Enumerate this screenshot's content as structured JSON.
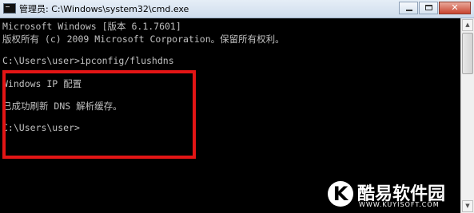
{
  "window": {
    "title": "管理员: C:\\Windows\\system32\\cmd.exe",
    "icon": "cmd-icon",
    "buttons": {
      "minimize": "minimize-icon",
      "maximize": "maximize-icon",
      "close": "✕"
    }
  },
  "console": {
    "lines": [
      "Microsoft Windows [版本 6.1.7601]",
      "版权所有 (c) 2009 Microsoft Corporation。保留所有权利。",
      "",
      "C:\\Users\\user>ipconfig/flushdns",
      "",
      "Windows IP 配置",
      "",
      "已成功刷新 DNS 解析缓存。",
      "",
      "C:\\Users\\user>"
    ]
  },
  "scrollbar": {
    "up": "▲",
    "down": "▼"
  },
  "highlight_color": "#e31515",
  "watermark": {
    "logo_letter": "K",
    "name": "酷易软件园",
    "url": "WWW.KUYISOFT.COM"
  }
}
